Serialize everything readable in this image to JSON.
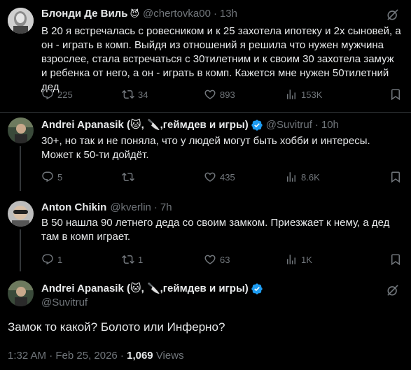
{
  "tweets": [
    {
      "name": "Блонди Де Виль",
      "name_emoji": "😈",
      "handle": "@chertovka00",
      "sep": "·",
      "time": "13h",
      "text": "В 20 я встречалась с ровесником и к 25 захотела ипотеку и 2х сыновей, а он - играть в комп. Выйдя из отношений я решила что нужен мужчина взрослее, стала встречаться с 30тилетним и к своим 30 захотела замуж и ребенка от него, а он - играть в комп. Кажется мне нужен 50тилетний дед",
      "replies": "225",
      "reposts": "34",
      "likes": "893",
      "views": "153K"
    },
    {
      "name": "Andrei Apanasik (🐱, 🔪,геймдев и игры)",
      "handle": "@Suvitruf",
      "sep": "·",
      "time": "10h",
      "text": "30+, но так и не поняла, что у людей могут быть хобби и интересы. Может к 50-ти дойдёт.",
      "replies": "5",
      "reposts": "",
      "likes": "435",
      "views": "8.6K"
    },
    {
      "name": "Anton Chikin",
      "handle": "@kverlin",
      "sep": "·",
      "time": "7h",
      "text": "В 50 нашла 90 летнего деда со своим замком. Приезжает к нему, а дед там в комп играет.",
      "replies": "1",
      "reposts": "1",
      "likes": "63",
      "views": "1K"
    }
  ],
  "main": {
    "name": "Andrei Apanasik (🐱, 🔪,геймдев и игры)",
    "handle": "@Suvitruf",
    "text": "Замок то какой? Болото или Инферно?",
    "timestamp": "1:32 AM · Feb 25, 2026 · ",
    "views_count": "1,069",
    "views_label": " Views"
  },
  "icons": [
    "reply-icon",
    "repost-icon",
    "like-icon",
    "views-icon",
    "bookmark-icon",
    "grok-icon",
    "verified-icon"
  ],
  "colors": {
    "background": "#000000",
    "text": "#e7e9ea",
    "muted": "#71767b",
    "verified": "#1d9bf0",
    "divider": "#2f3336"
  }
}
